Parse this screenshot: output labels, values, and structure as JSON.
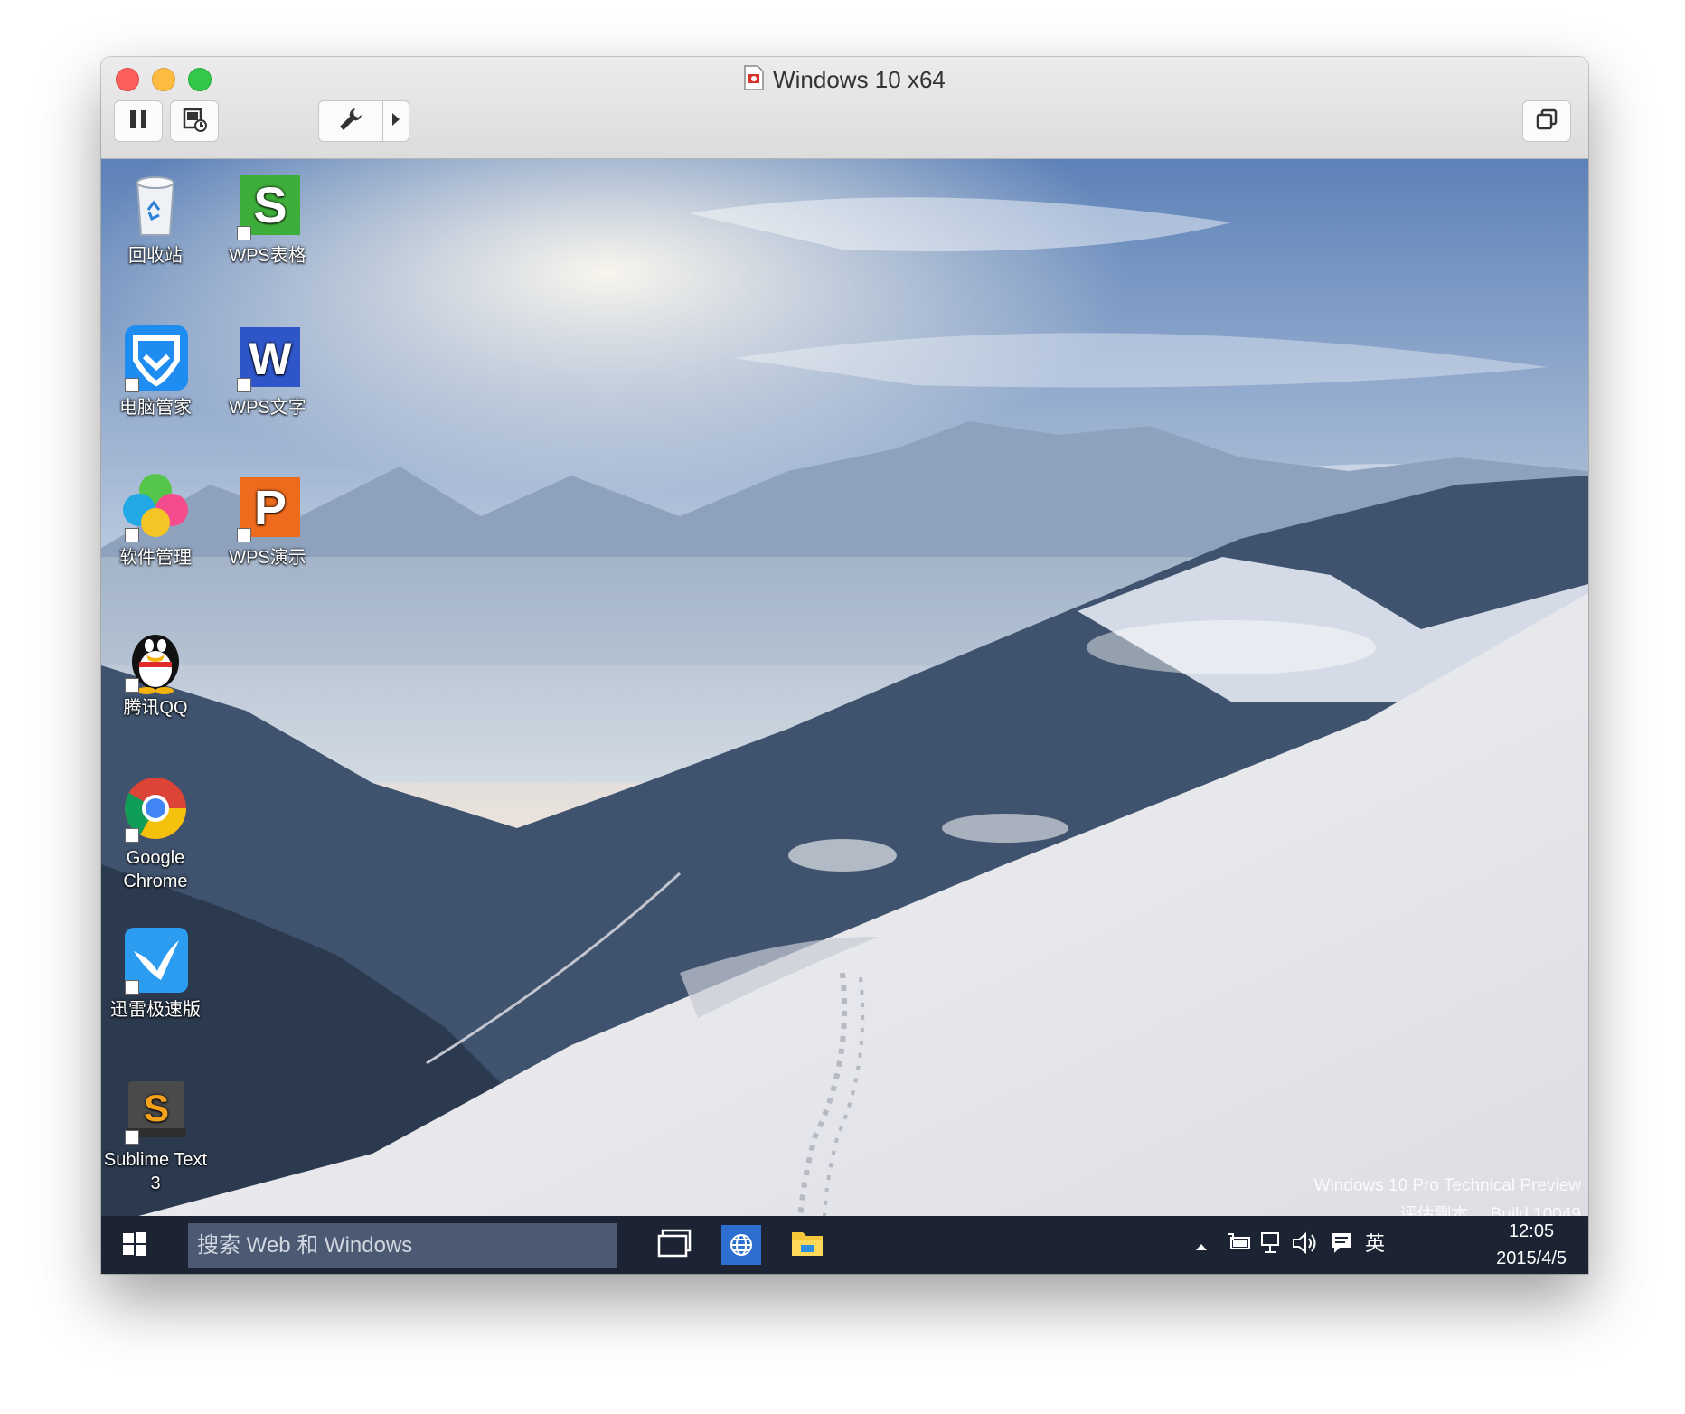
{
  "window": {
    "title": "Windows 10 x64"
  },
  "toolbar": {
    "pause_icon": "pause-icon",
    "snapshot_icon": "snapshot-icon",
    "settings_icon": "wrench-icon",
    "more_icon": "chevron-right-icon",
    "fullscreen_icon": "restore-icon"
  },
  "desktop": {
    "icons": [
      {
        "label": "回收站"
      },
      {
        "label": "WPS表格"
      },
      {
        "label": "电脑管家"
      },
      {
        "label": "WPS文字"
      },
      {
        "label": "软件管理"
      },
      {
        "label": "WPS演示"
      },
      {
        "label": "腾讯QQ"
      },
      {
        "label": "Google Chrome"
      },
      {
        "label": "迅雷极速版"
      },
      {
        "label": "Sublime Text 3"
      }
    ],
    "watermark_line1": "Windows 10 Pro Technical Preview",
    "watermark_line2": "评估副本。 Build 10049"
  },
  "taskbar": {
    "search_placeholder": "搜索 Web 和 Windows",
    "ime": "英",
    "time": "12:05",
    "date": "2015/4/5"
  }
}
